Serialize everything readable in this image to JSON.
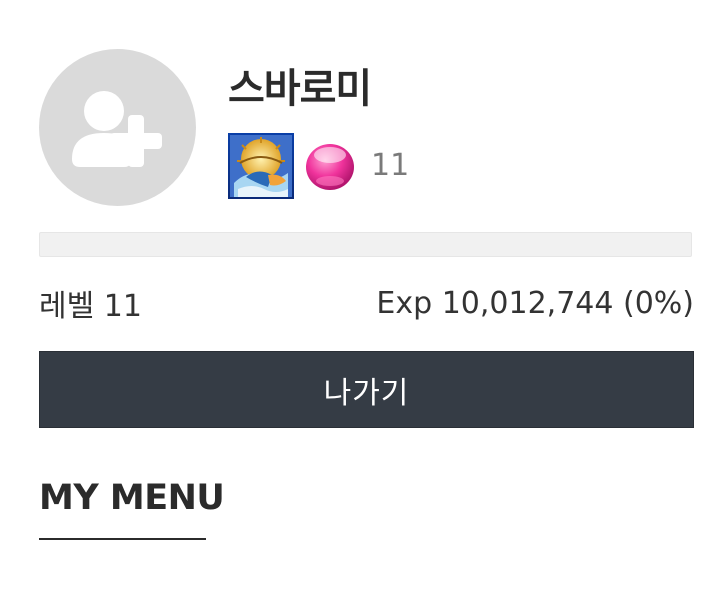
{
  "profile": {
    "username": "스바로미",
    "avatar_icon": "add-user-icon",
    "class_icon": "class-emblem-icon",
    "gem_icon": "pink-gem-icon",
    "gem_count": "11"
  },
  "experience": {
    "progress_percent": 0,
    "level_text": "레벨 11",
    "exp_text": "Exp 10,012,744 (0%)"
  },
  "actions": {
    "leave_label": "나가기"
  },
  "menu": {
    "title": "MY MENU"
  },
  "colors": {
    "button_bg": "#353c45",
    "avatar_bg": "#dadada",
    "bar_bg": "#f1f1f1",
    "gem_pink": "#f0339c"
  }
}
